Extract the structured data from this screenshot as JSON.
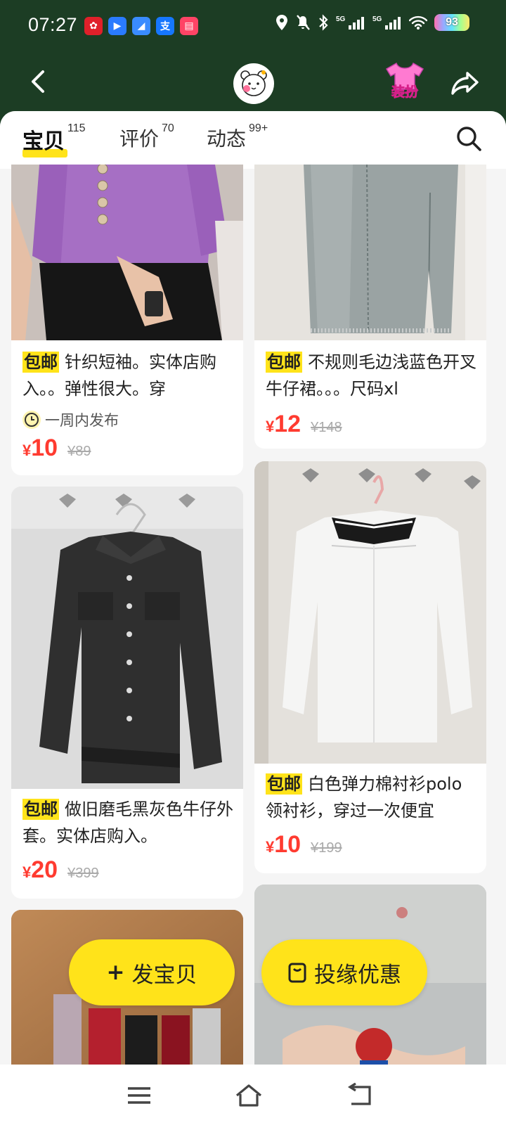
{
  "status": {
    "time": "07:27",
    "battery": "93"
  },
  "header": {
    "dressup_label": "装扮"
  },
  "tabs": [
    {
      "label": "宝贝",
      "count": "115"
    },
    {
      "label": "评价",
      "count": "70"
    },
    {
      "label": "动态",
      "count": "99+"
    }
  ],
  "items": [
    {
      "badge": "包邮",
      "title": "针织短袖。实体店购入。。弹性很大。穿",
      "meta": "一周内发布",
      "currency": "¥",
      "price": "10",
      "original": "¥89"
    },
    {
      "badge": "包邮",
      "title": "不规则毛边浅蓝色开叉牛仔裙。。。尺码xl",
      "currency": "¥",
      "price": "12",
      "original": "¥148"
    },
    {
      "badge": "包邮",
      "title": "做旧磨毛黑灰色牛仔外套。实体店购入。",
      "currency": "¥",
      "price": "20",
      "original": "¥399"
    },
    {
      "badge": "包邮",
      "title": "白色弹力棉衬衫polo领衬衫，穿过一次便宜",
      "currency": "¥",
      "price": "10",
      "original": "¥199"
    }
  ],
  "actions": {
    "publish": "发宝贝",
    "publish_prefix": "+",
    "promo": "投缘优惠"
  },
  "colors": {
    "header_bg": "#1c3d24",
    "accent_yellow": "#ffe31a",
    "price_red": "#ff3b30"
  }
}
